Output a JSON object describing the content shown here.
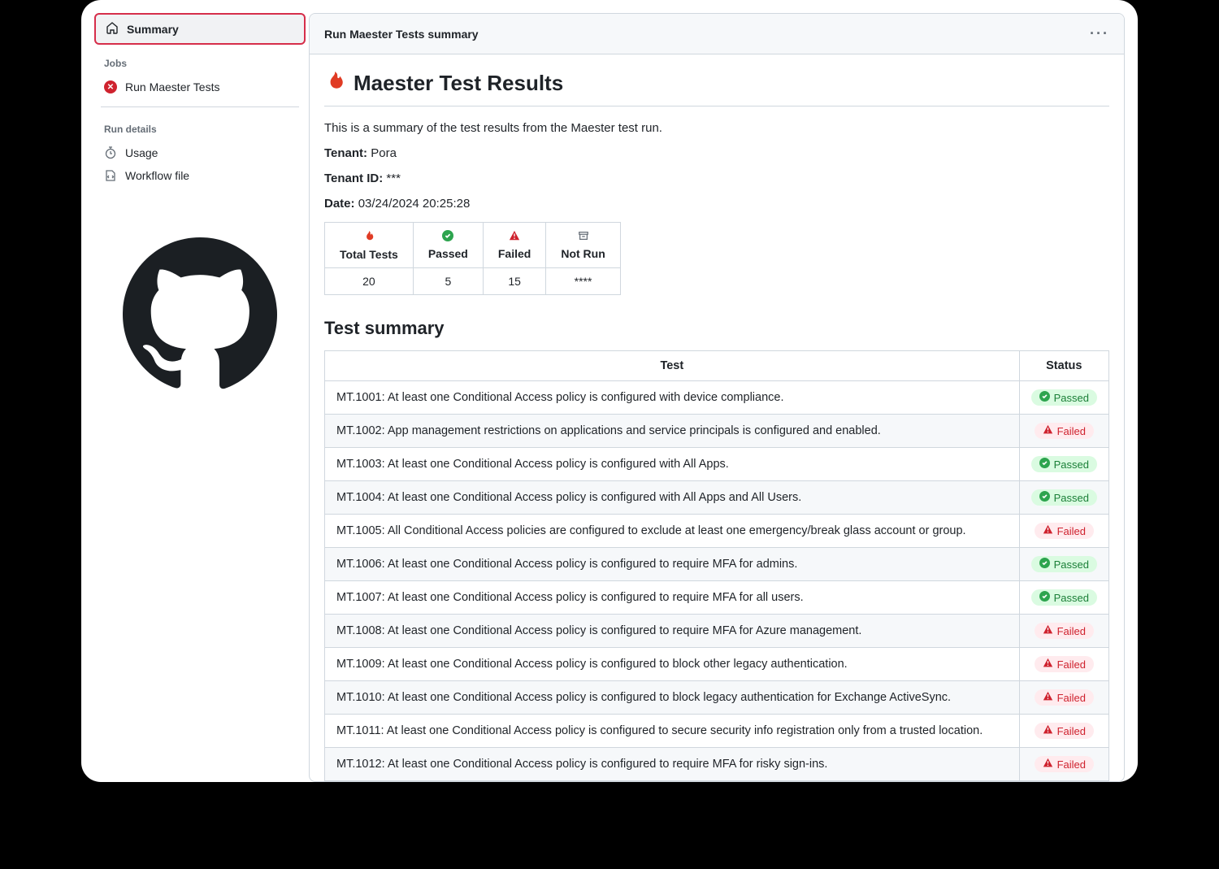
{
  "sidebar": {
    "summary": "Summary",
    "jobs_label": "Jobs",
    "job_item": "Run Maester Tests",
    "run_details_label": "Run details",
    "usage": "Usage",
    "workflow_file": "Workflow file"
  },
  "panel": {
    "header_title": "Run Maester Tests summary",
    "page_title": "Maester Test Results",
    "intro": "This is a summary of the test results from the Maester test run.",
    "tenant_label": "Tenant:",
    "tenant_value": "Pora",
    "tenant_id_label": "Tenant ID:",
    "tenant_id_value": "***",
    "date_label": "Date:",
    "date_value": "03/24/2024 20:25:28"
  },
  "stats": {
    "total_label": "Total Tests",
    "passed_label": "Passed",
    "failed_label": "Failed",
    "notrun_label": "Not Run",
    "total": "20",
    "passed": "5",
    "failed": "15",
    "notrun": "****"
  },
  "summary": {
    "title": "Test summary",
    "col_test": "Test",
    "col_status": "Status",
    "rows": [
      {
        "test": "MT.1001: At least one Conditional Access policy is configured with device compliance.",
        "status": "Passed"
      },
      {
        "test": "MT.1002: App management restrictions on applications and service principals is configured and enabled.",
        "status": "Failed"
      },
      {
        "test": "MT.1003: At least one Conditional Access policy is configured with All Apps.",
        "status": "Passed"
      },
      {
        "test": "MT.1004: At least one Conditional Access policy is configured with All Apps and All Users.",
        "status": "Passed"
      },
      {
        "test": "MT.1005: All Conditional Access policies are configured to exclude at least one emergency/break glass account or group.",
        "status": "Failed"
      },
      {
        "test": "MT.1006: At least one Conditional Access policy is configured to require MFA for admins.",
        "status": "Passed"
      },
      {
        "test": "MT.1007: At least one Conditional Access policy is configured to require MFA for all users.",
        "status": "Passed"
      },
      {
        "test": "MT.1008: At least one Conditional Access policy is configured to require MFA for Azure management.",
        "status": "Failed"
      },
      {
        "test": "MT.1009: At least one Conditional Access policy is configured to block other legacy authentication.",
        "status": "Failed"
      },
      {
        "test": "MT.1010: At least one Conditional Access policy is configured to block legacy authentication for Exchange ActiveSync.",
        "status": "Failed"
      },
      {
        "test": "MT.1011: At least one Conditional Access policy is configured to secure security info registration only from a trusted location.",
        "status": "Failed"
      },
      {
        "test": "MT.1012: At least one Conditional Access policy is configured to require MFA for risky sign-ins.",
        "status": "Failed"
      }
    ]
  }
}
